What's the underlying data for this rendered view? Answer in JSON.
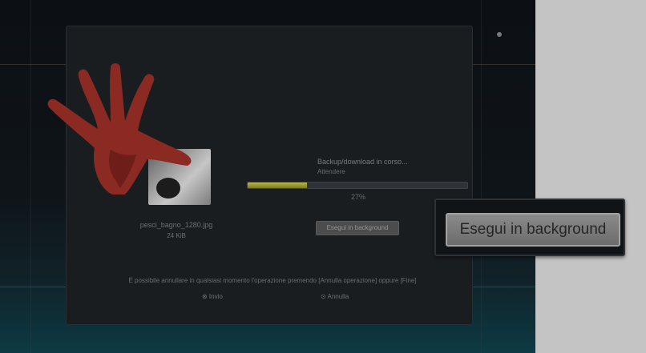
{
  "dialog": {
    "file_name": "pesci_bagno_1280.jpg",
    "file_size": "24 KiB",
    "status_title": "Backup/download in corso...",
    "status_sub": "Attendere",
    "progress_percent": 27,
    "percent_text": "27%",
    "background_button_label": "Esegui in background",
    "info_text": "È possibile annullare in qualsiasi momento l'operazione premendo [Annulla operazione] oppure [Fine]",
    "action_ok": "⊗ Invio",
    "action_cancel": "⊙ Annulla"
  },
  "zoom": {
    "label": "Esegui in background"
  },
  "colors": {
    "progress": "#b8b54a",
    "hand": "#8a2a22"
  }
}
